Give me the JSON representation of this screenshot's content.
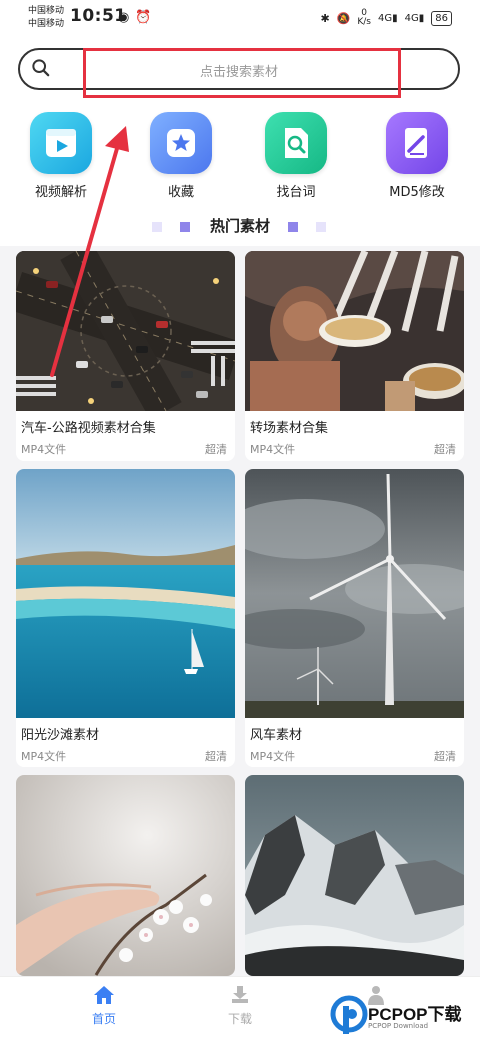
{
  "status": {
    "carrier1": "中国移动",
    "carrier2": "中国移动",
    "time": "10:51",
    "net_speed_top": "0",
    "net_speed_unit": "K/s",
    "signal1": "4G",
    "signal2": "4G",
    "battery": "86"
  },
  "search": {
    "placeholder": "点击搜索素材"
  },
  "quick_actions": [
    {
      "label": "视频解析",
      "icon": "video-play-icon",
      "color": "#26c3e8"
    },
    {
      "label": "收藏",
      "icon": "star-icon",
      "color": "#5b8cf5"
    },
    {
      "label": "找台词",
      "icon": "search-document-icon",
      "color": "#27cc98"
    },
    {
      "label": "MD5修改",
      "icon": "edit-document-icon",
      "color": "#8a5ef0"
    }
  ],
  "section": {
    "title": "热门素材"
  },
  "cards": [
    {
      "title": "汽车-公路视频素材合集",
      "type": "MP4文件",
      "quality": "超清"
    },
    {
      "title": "转场素材合集",
      "type": "MP4文件",
      "quality": "超清"
    },
    {
      "title": "阳光沙滩素材",
      "type": "MP4文件",
      "quality": "超清"
    },
    {
      "title": "风车素材",
      "type": "MP4文件",
      "quality": "超清"
    }
  ],
  "tabs": {
    "home": "首页",
    "download": "下载"
  },
  "watermark": {
    "brand": "PCPOP下载",
    "sub": "PCPOP Download"
  }
}
